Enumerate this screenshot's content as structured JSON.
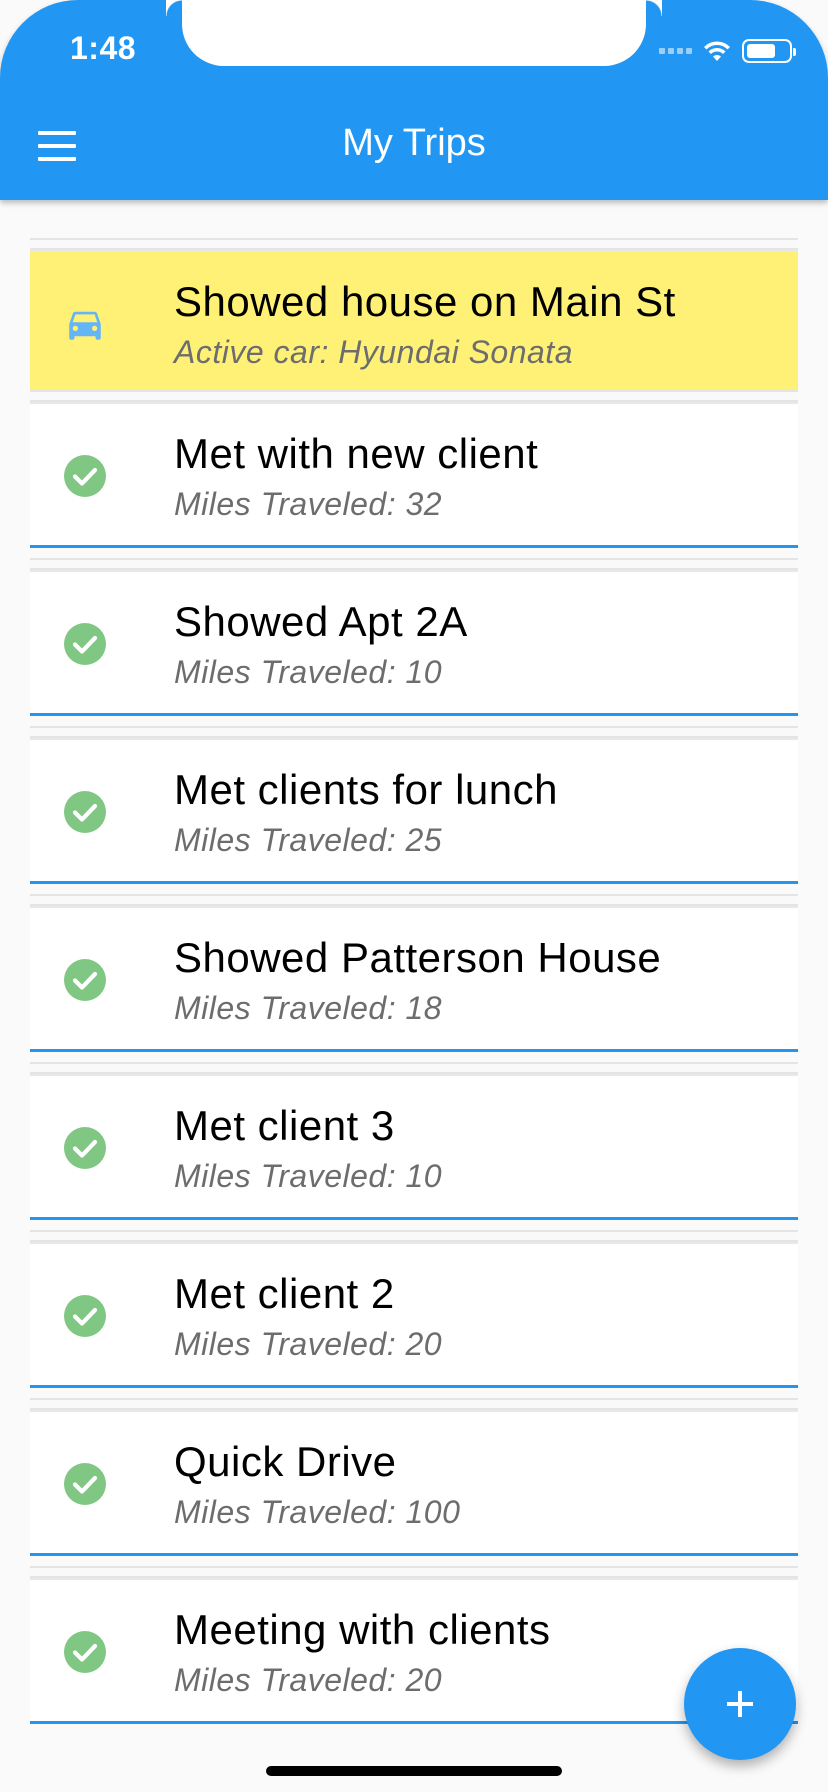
{
  "status_bar": {
    "time": "1:48"
  },
  "app_bar": {
    "title": "My Trips",
    "menu_icon": "hamburger-menu-icon",
    "background": "#2196f3"
  },
  "trips": [
    {
      "title": "Showed house on Main St",
      "subtitle": "Active car: Hyundai Sonata",
      "status": "active",
      "icon": "car-icon"
    },
    {
      "title": "Met with new client",
      "subtitle": "Miles Traveled: 32",
      "status": "completed",
      "icon": "check-circle-icon"
    },
    {
      "title": "Showed Apt 2A",
      "subtitle": "Miles Traveled: 10",
      "status": "completed",
      "icon": "check-circle-icon"
    },
    {
      "title": "Met clients for lunch",
      "subtitle": "Miles Traveled: 25",
      "status": "completed",
      "icon": "check-circle-icon"
    },
    {
      "title": "Showed Patterson House",
      "subtitle": "Miles Traveled: 18",
      "status": "completed",
      "icon": "check-circle-icon"
    },
    {
      "title": "Met client 3",
      "subtitle": "Miles Traveled: 10",
      "status": "completed",
      "icon": "check-circle-icon"
    },
    {
      "title": "Met client 2",
      "subtitle": "Miles Traveled: 20",
      "status": "completed",
      "icon": "check-circle-icon"
    },
    {
      "title": "Quick Drive",
      "subtitle": "Miles Traveled: 100",
      "status": "completed",
      "icon": "check-circle-icon"
    },
    {
      "title": "Meeting with clients",
      "subtitle": "Miles Traveled: 20",
      "status": "completed",
      "icon": "check-circle-icon"
    }
  ],
  "fab": {
    "icon": "plus-icon"
  },
  "colors": {
    "primary": "#2196f3",
    "active_row": "#fff176",
    "completed_check": "#81c784",
    "car_icon": "#64b5f6"
  }
}
